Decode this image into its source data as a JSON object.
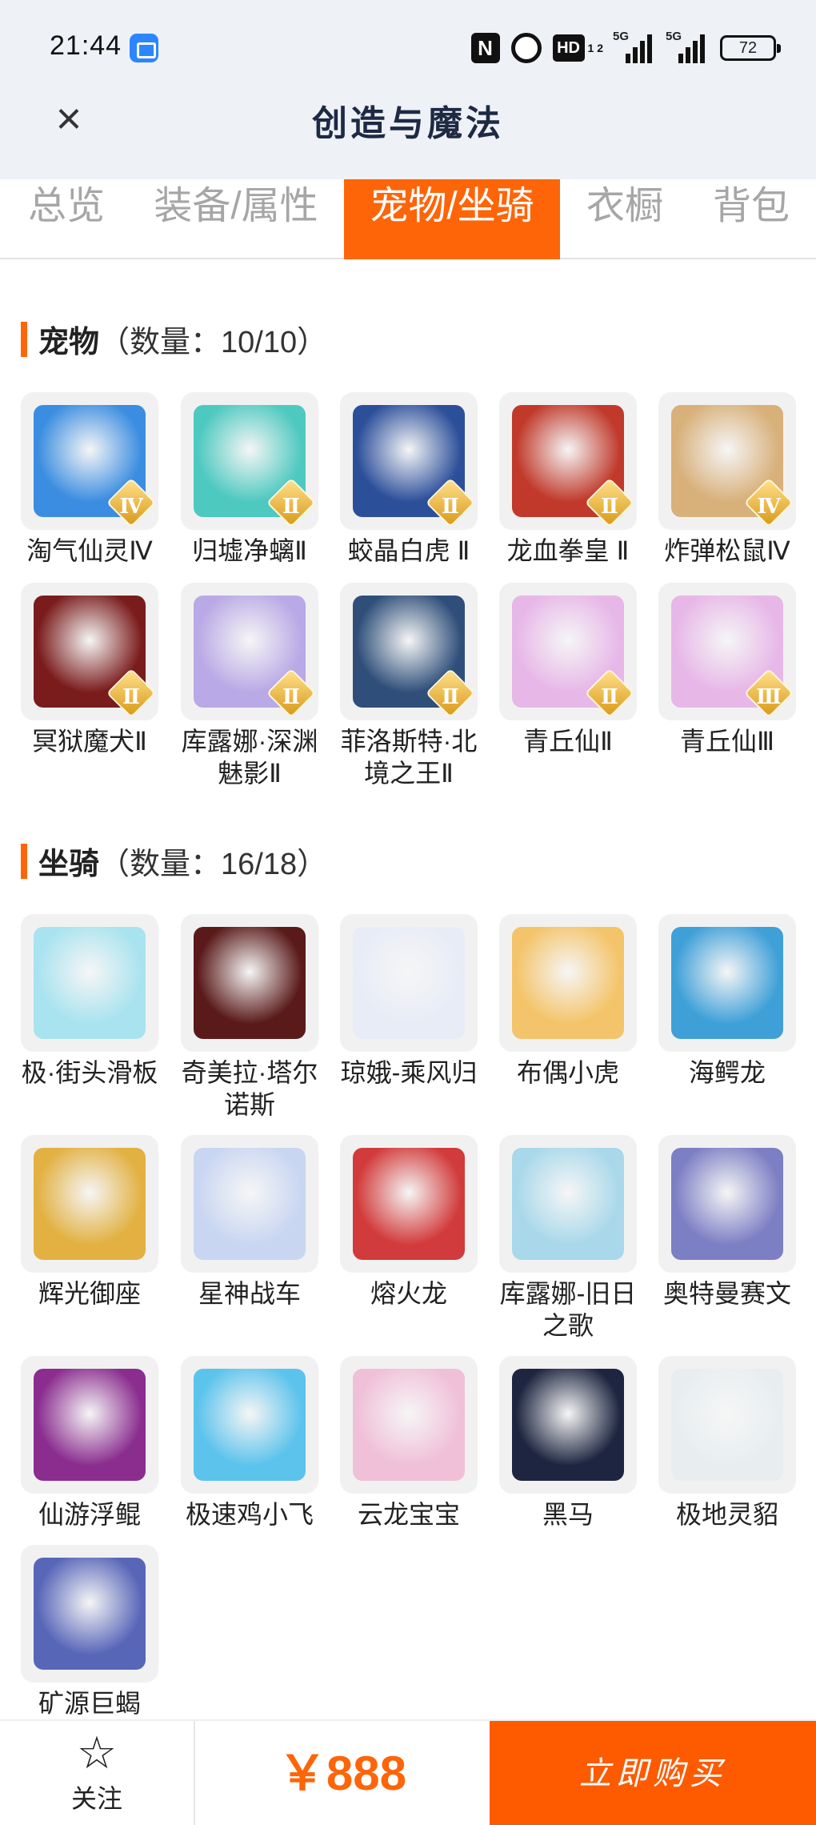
{
  "status_bar": {
    "time": "21:44",
    "hd_sub": "1 2",
    "net1": "5G",
    "net2": "5G",
    "battery": "72"
  },
  "header": {
    "title": "创造与魔法"
  },
  "tabs": [
    {
      "label": "总览"
    },
    {
      "label": "装备/属性"
    },
    {
      "label": "宠物/坐骑",
      "active": true
    },
    {
      "label": "衣橱"
    },
    {
      "label": "背包"
    }
  ],
  "pets": {
    "title": "宠物",
    "count": "（数量：10/10）",
    "items": [
      {
        "name": "淘气仙灵Ⅳ",
        "badge": "Ⅳ",
        "color": "#3a8de0"
      },
      {
        "name": "归墟净螭Ⅱ",
        "badge": "Ⅱ",
        "color": "#4ec9c0"
      },
      {
        "name": "蛟晶白虎 Ⅱ",
        "badge": "Ⅱ",
        "color": "#2c4f9a"
      },
      {
        "name": "龙血拳皇 Ⅱ",
        "badge": "Ⅱ",
        "color": "#c0392b"
      },
      {
        "name": "炸弹松鼠Ⅳ",
        "badge": "Ⅳ",
        "color": "#d8b07a"
      },
      {
        "name": "冥狱魔犬Ⅱ",
        "badge": "Ⅱ",
        "color": "#7a1c1c"
      },
      {
        "name": "库露娜·深渊魅影Ⅱ",
        "badge": "Ⅱ",
        "color": "#b9a9e6"
      },
      {
        "name": "菲洛斯特·北境之王Ⅱ",
        "badge": "Ⅱ",
        "color": "#2f4f7a"
      },
      {
        "name": "青丘仙Ⅱ",
        "badge": "Ⅱ",
        "color": "#e7b7e8"
      },
      {
        "name": "青丘仙Ⅲ",
        "badge": "Ⅲ",
        "color": "#e7b7e8"
      }
    ]
  },
  "mounts": {
    "title": "坐骑",
    "count": "（数量：16/18）",
    "items": [
      {
        "name": "极·街头滑板",
        "color": "#a9e3ef"
      },
      {
        "name": "奇美拉·塔尔诺斯",
        "color": "#5a1a1a"
      },
      {
        "name": "琼娥-乘风归",
        "color": "#e8ecf7"
      },
      {
        "name": "布偶小虎",
        "color": "#f4c46a"
      },
      {
        "name": "海鳄龙",
        "color": "#3fa0d8"
      },
      {
        "name": "辉光御座",
        "color": "#e2b142"
      },
      {
        "name": "星神战车",
        "color": "#c9d6f2"
      },
      {
        "name": "熔火龙",
        "color": "#d23b3b"
      },
      {
        "name": "库露娜-旧日之歌",
        "color": "#a8d8ea"
      },
      {
        "name": "奥特曼赛文",
        "color": "#7d7fc4"
      },
      {
        "name": "仙游浮鲲",
        "color": "#8a2d8f"
      },
      {
        "name": "极速鸡小飞",
        "color": "#5cc3ec"
      },
      {
        "name": "云龙宝宝",
        "color": "#f0c0d8"
      },
      {
        "name": "黑马",
        "color": "#1d2540"
      },
      {
        "name": "极地灵貂",
        "color": "#e8eef0"
      },
      {
        "name": "矿源巨蝎",
        "color": "#5866b8"
      }
    ]
  },
  "bottom": {
    "follow_label": "关注",
    "price": "￥888",
    "buy_label": "立即购买"
  }
}
